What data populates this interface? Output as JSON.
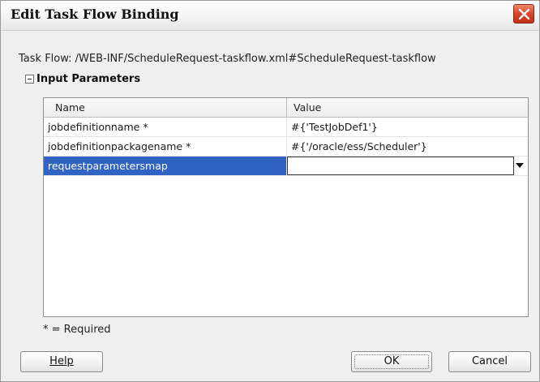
{
  "dialog": {
    "title": "Edit Task Flow Binding",
    "task_flow_label": "Task Flow: /WEB-INF/ScheduleRequest-taskflow.xml#ScheduleRequest-taskflow"
  },
  "input_parameters": {
    "section_title": "Input Parameters",
    "columns": [
      "Name",
      "Value"
    ],
    "rows": [
      {
        "name": "jobdefinitionname *",
        "value": "#{'TestJobDef1'}"
      },
      {
        "name": "jobdefinitionpackagename *",
        "value": "#{'/oracle/ess/Scheduler'}"
      },
      {
        "name": "requestparametersmap",
        "value": ""
      }
    ],
    "selected_row_index": 2
  },
  "required_note": "* = Required",
  "buttons": {
    "help": "Help",
    "ok": "OK",
    "cancel": "Cancel"
  },
  "colors": {
    "selection": "#3163c5",
    "close_button": "#d9432a"
  },
  "icons": {
    "close": "close-icon",
    "collapse": "collapse-minus-icon",
    "dropdown": "chevron-down-icon"
  }
}
